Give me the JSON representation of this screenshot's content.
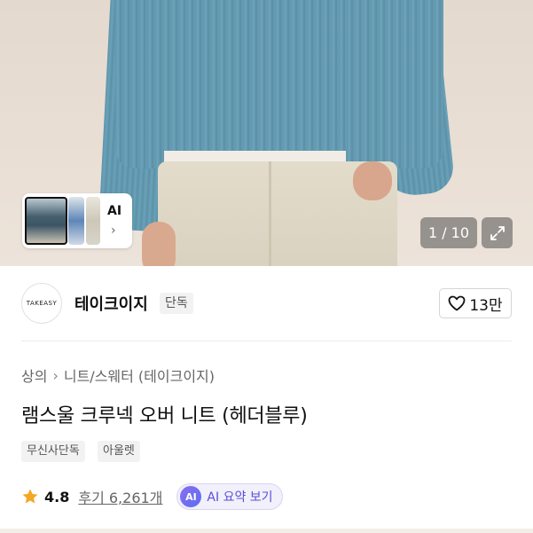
{
  "hero": {
    "ai_card_label": "AI",
    "counter": "1 / 10"
  },
  "brand": {
    "logo_text": "TAKEASY",
    "name": "테이크이지",
    "badge": "단독",
    "likes": "13만"
  },
  "breadcrumb": {
    "items": [
      "상의",
      "니트/스웨터 (테이크이지)"
    ]
  },
  "product": {
    "title": "램스울 크루넥 오버 니트 (헤더블루)",
    "tags": [
      "무신사단독",
      "아울렛"
    ],
    "rating": "4.8",
    "reviews": "후기 6,261개",
    "ai_summary_icon": "AI",
    "ai_summary_label": "AI 요약 보기"
  },
  "colors": {
    "star": "#f5a623",
    "ai_accent": "#5a4fd6"
  }
}
